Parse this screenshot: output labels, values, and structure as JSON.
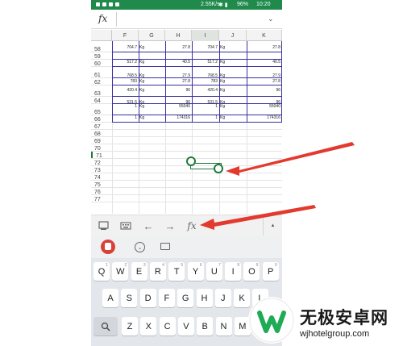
{
  "status": {
    "speed": "2.55K/s",
    "battery": "96%",
    "time": "10:20"
  },
  "formula_bar": {
    "fx": "fx",
    "chevron": "⌄"
  },
  "columns": [
    "F",
    "G",
    "H",
    "I",
    "J",
    "K"
  ],
  "rows": [
    "58",
    "59",
    "60",
    "61",
    "62",
    "63",
    "64",
    "65",
    "66",
    "67",
    "68",
    "69",
    "70",
    "71",
    "72",
    "73",
    "74",
    "75",
    "76",
    "77"
  ],
  "cells": [
    [
      "704.7",
      "Kg",
      "27.8",
      "704.7",
      "Kg",
      "27.8"
    ],
    [
      "517.2",
      "Kg",
      "40.5",
      "517.2",
      "Kg",
      "40.5"
    ],
    [
      "768.5",
      "Kg",
      "27.9",
      "768.5",
      "Kg",
      "27.9"
    ],
    [
      "783",
      "Kg",
      "27.8",
      "783",
      "Kg",
      "27.8"
    ],
    [
      "420.4",
      "Kg",
      "96",
      "420.4",
      "Kg",
      "96"
    ],
    [
      "531.5",
      "Kg",
      "96",
      "531.5",
      "Kg",
      "96"
    ],
    [
      "1",
      "Kg",
      "55040",
      "1",
      "Kg",
      "55040"
    ],
    [
      "1",
      "Kg",
      "174316",
      "1",
      "Kg",
      "174316"
    ]
  ],
  "toolbar": {
    "fx": "fx",
    "back": "←",
    "forward": "→",
    "expand": "▲"
  },
  "keyboard": {
    "row1": [
      "Q",
      "W",
      "E",
      "R",
      "T",
      "Y",
      "U",
      "I",
      "O",
      "P"
    ],
    "row1_hints": [
      "1",
      "2",
      "3",
      "4",
      "5",
      "6",
      "7",
      "8",
      "9",
      "0"
    ],
    "row2": [
      "A",
      "S",
      "D",
      "F",
      "G",
      "H",
      "J",
      "K",
      "L"
    ],
    "row3": [
      "Z",
      "X",
      "C",
      "V",
      "B",
      "N",
      "M"
    ]
  },
  "watermark": {
    "title": "无极安卓网",
    "url": "wjhotelgroup.com"
  },
  "colors": {
    "status_bar": "#1f8a4c",
    "selection": "#1f7a3a",
    "border_blue": "#3a2f9e",
    "arrow_red": "#e23a2e"
  }
}
